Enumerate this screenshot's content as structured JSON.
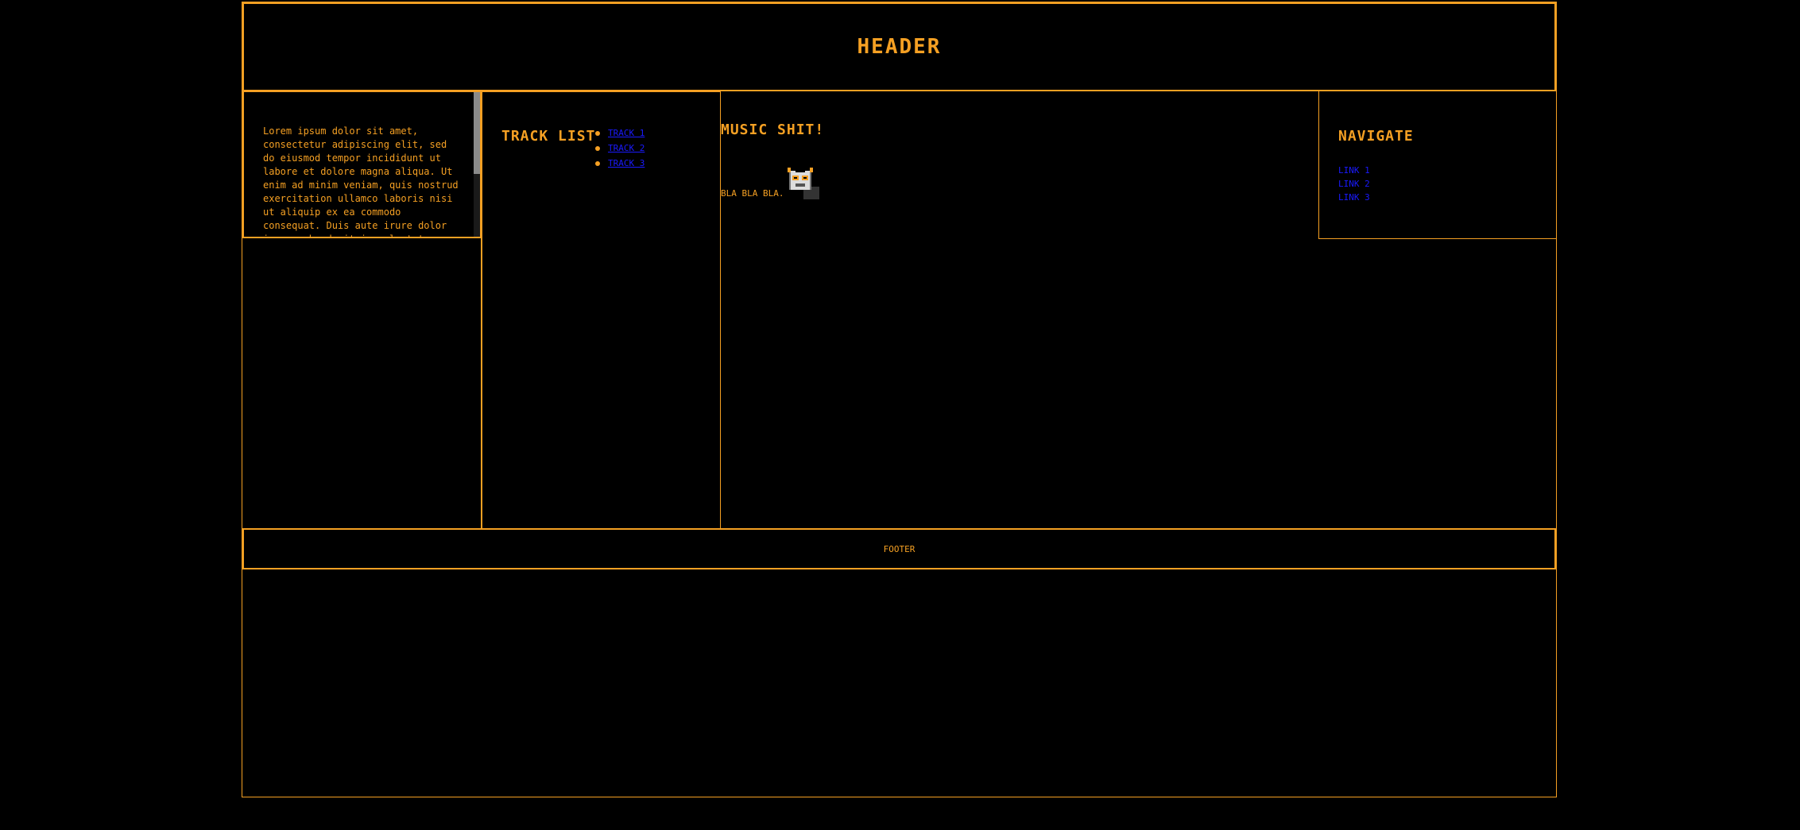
{
  "header": {
    "title": "HEADER"
  },
  "about": {
    "text": "Lorem ipsum dolor sit amet, consectetur adipiscing elit, sed do eiusmod tempor incididunt ut labore et dolore magna aliqua. Ut enim ad minim veniam, quis nostrud exercitation ullamco laboris nisi ut aliquip ex ea commodo consequat. Duis aute irure dolor in reprehenderit in voluptate velit esse cillum dolore eu fugiat"
  },
  "tracklist": {
    "title": "TRACK LIST",
    "items": [
      {
        "label": "TRACK 1"
      },
      {
        "label": "TRACK 2"
      },
      {
        "label": "TRACK 3"
      }
    ]
  },
  "main": {
    "title": "MUSIC SHIT!",
    "text": "BLA BLA BLA.",
    "avatar_icon": "pixel-cat-avatar-icon"
  },
  "navigate": {
    "title": "NAVIGATE",
    "links": [
      {
        "label": "LINK 1"
      },
      {
        "label": "LINK 2"
      },
      {
        "label": "LINK 3"
      }
    ]
  },
  "footer": {
    "text": "FOOTER"
  },
  "colors": {
    "accent": "#f5a023",
    "background": "#000000",
    "link": "#1a1aff"
  }
}
